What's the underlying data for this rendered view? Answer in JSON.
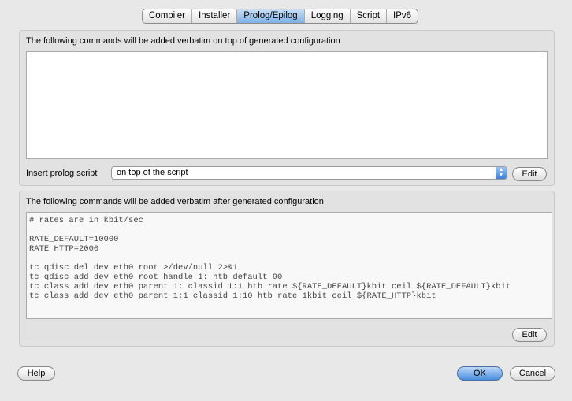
{
  "tabs": [
    "Compiler",
    "Installer",
    "Prolog/Epilog",
    "Logging",
    "Script",
    "IPv6"
  ],
  "active_tab": "Prolog/Epilog",
  "prolog": {
    "label": "The following commands will be added verbatim on top of generated configuration",
    "text": "",
    "insert_label": "Insert prolog script",
    "insert_value": "on top of the script",
    "edit": "Edit"
  },
  "epilog": {
    "label": "The following commands will be added verbatim after generated configuration",
    "text": "# rates are in kbit/sec\n\nRATE_DEFAULT=10000\nRATE_HTTP=2000\n\ntc qdisc del dev eth0 root >/dev/null 2>&1\ntc qdisc add dev eth0 root handle 1: htb default 90\ntc class add dev eth0 parent 1: classid 1:1 htb rate ${RATE_DEFAULT}kbit ceil ${RATE_DEFAULT}kbit\ntc class add dev eth0 parent 1:1 classid 1:10 htb rate 1kbit ceil ${RATE_HTTP}kbit",
    "edit": "Edit"
  },
  "buttons": {
    "help": "Help",
    "ok": "OK",
    "cancel": "Cancel"
  }
}
